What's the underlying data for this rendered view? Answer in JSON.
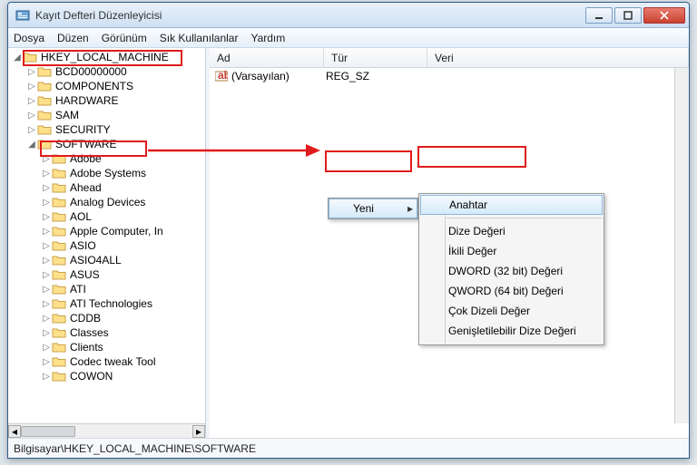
{
  "window": {
    "title": "Kayıt Defteri Düzenleyicisi"
  },
  "menu": {
    "file": "Dosya",
    "edit": "Düzen",
    "view": "Görünüm",
    "favorites": "Sık Kullanılanlar",
    "help": "Yardım"
  },
  "tree": {
    "root": "HKEY_LOCAL_MACHINE",
    "level1": [
      "BCD00000000",
      "COMPONENTS",
      "HARDWARE",
      "SAM",
      "SECURITY",
      "SOFTWARE"
    ],
    "software_children": [
      "Adobe",
      "Adobe Systems",
      "Ahead",
      "Analog Devices",
      "AOL",
      "Apple Computer, In",
      "ASIO",
      "ASIO4ALL",
      "ASUS",
      "ATI",
      "ATI Technologies",
      "CDDB",
      "Classes",
      "Clients",
      "Codec tweak Tool",
      "COWON"
    ]
  },
  "columns": {
    "name": "Ad",
    "type": "Tür",
    "data": "Veri"
  },
  "default_value": {
    "name": "(Varsayılan)",
    "type": "REG_SZ",
    "data": ""
  },
  "ctx": {
    "new": "Yeni",
    "items": {
      "key": "Anahtar",
      "string": "Dize Değeri",
      "binary": "İkili Değer",
      "dword": "DWORD (32 bit) Değeri",
      "qword": "QWORD (64 bit) Değeri",
      "multi": "Çok Dizeli Değer",
      "expand": "Genişletilebilir Dize Değeri"
    }
  },
  "statusbar": "Bilgisayar\\HKEY_LOCAL_MACHINE\\SOFTWARE"
}
